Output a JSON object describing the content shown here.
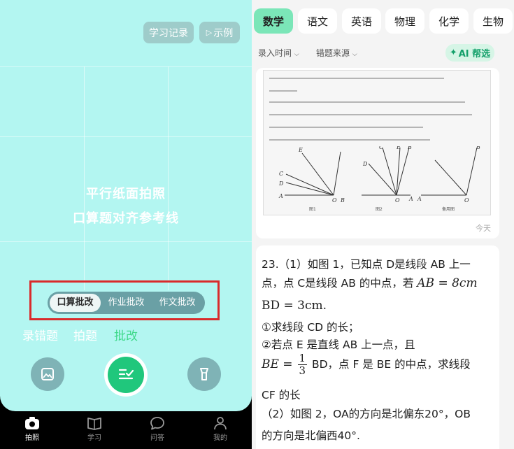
{
  "camera": {
    "history_label": "学习记录",
    "example_label": "示例",
    "hint_line1": "平行纸面拍照",
    "hint_line2": "口算题对齐参考线",
    "correction_modes": [
      "口算批改",
      "作业批改",
      "作文批改"
    ],
    "active_correction_mode": "口算批改",
    "mode_tabs": [
      "录错题",
      "拍题",
      "批改"
    ],
    "active_mode_tab": "批改"
  },
  "bottom_nav": {
    "items": [
      "拍照",
      "学习",
      "问答",
      "我的"
    ],
    "active": "拍照"
  },
  "notebook": {
    "subjects": [
      "数学",
      "语文",
      "英语",
      "物理",
      "化学",
      "生物"
    ],
    "active_subject": "数学",
    "filter_time": "录入时间",
    "filter_source": "错题来源",
    "ai_button": "AI 帮选",
    "card1_date": "今天",
    "q_line1": "23.（1）如图 1，已知点 D是线段 AB 上一",
    "q_line2a": "点，点 C是线段 AB 的中点，若",
    "q_line2b": "AB = 8cm",
    "q_line3": "BD = 3cm.",
    "q_line4": "①求线段 CD 的长；",
    "q_line5": "②若点 E 是直线 AB 上一点，且",
    "q_line6a": "BE =",
    "q_frac_num": "1",
    "q_frac_den": "3",
    "q_line6b": "BD，点 F 是 BE 的中点，求线段",
    "q_line7": "CF 的长",
    "q_line8": "（2）如图 2，OA的方向是北偏东20°，OB",
    "q_line9": "的方向是北偏西40°."
  },
  "colors": {
    "camera_bg": "#b3f6f1",
    "accent_green": "#20c77c",
    "highlight_red": "#d92b2b",
    "subject_active": "#7be6b8"
  }
}
